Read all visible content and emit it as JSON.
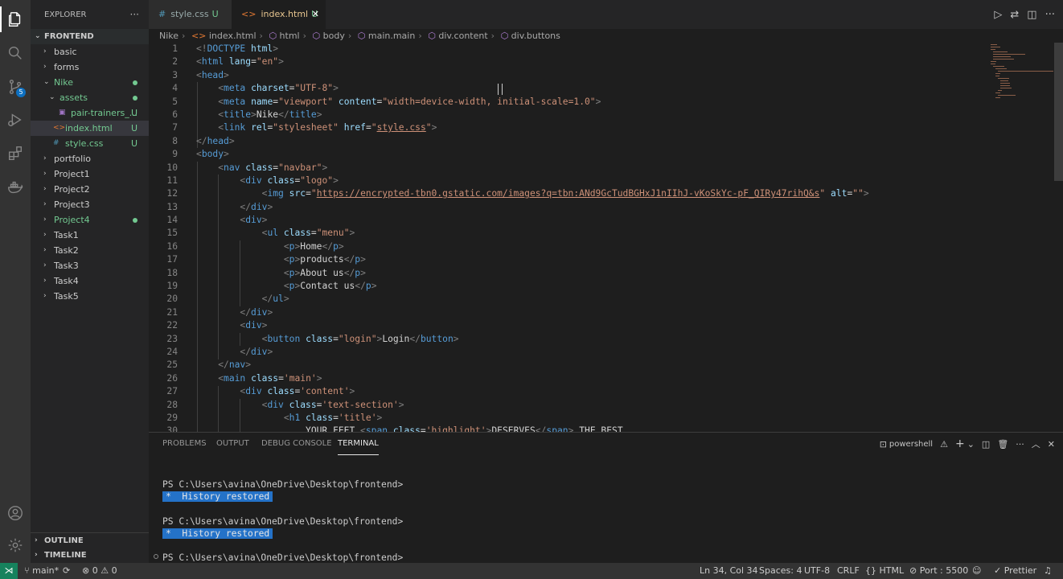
{
  "explorer": {
    "title": "EXPLORER",
    "more": "···",
    "root": "FRONTEND",
    "tree": [
      {
        "label": "basic",
        "chev": "›",
        "indent": 0
      },
      {
        "label": "forms",
        "chev": "›",
        "indent": 0
      },
      {
        "label": "Nike",
        "chev": "⌄",
        "indent": 0,
        "green": true,
        "dot": true
      },
      {
        "label": "assets",
        "chev": "⌄",
        "indent": 1,
        "green": true,
        "dot": true
      },
      {
        "label": "pair-trainers_...",
        "icon": "▣",
        "indent": 2,
        "green": true,
        "badge": "U"
      },
      {
        "label": "index.html",
        "icon": "<>",
        "indent": 1,
        "green": true,
        "badge": "U",
        "selected": true
      },
      {
        "label": "style.css",
        "icon": "#",
        "indent": 1,
        "green": true,
        "badge": "U"
      },
      {
        "label": "portfolio",
        "chev": "›",
        "indent": 0
      },
      {
        "label": "Project1",
        "chev": "›",
        "indent": 0
      },
      {
        "label": "Project2",
        "chev": "›",
        "indent": 0
      },
      {
        "label": "Project3",
        "chev": "›",
        "indent": 0
      },
      {
        "label": "Project4",
        "chev": "›",
        "indent": 0,
        "green": true,
        "dot": true
      },
      {
        "label": "Task1",
        "chev": "›",
        "indent": 0
      },
      {
        "label": "Task2",
        "chev": "›",
        "indent": 0
      },
      {
        "label": "Task3",
        "chev": "›",
        "indent": 0
      },
      {
        "label": "Task4",
        "chev": "›",
        "indent": 0
      },
      {
        "label": "Task5",
        "chev": "›",
        "indent": 0
      }
    ],
    "outline": "OUTLINE",
    "timeline": "TIMELINE"
  },
  "scm_badge": "5",
  "tabs": [
    {
      "icon": "#",
      "label": "style.css",
      "mod": "U"
    },
    {
      "icon": "<>",
      "label": "index.html",
      "mod": "U",
      "close": "✕"
    }
  ],
  "breadcrumbs": [
    "Nike",
    "index.html",
    "html",
    "body",
    "main.main",
    "div.content",
    "div.buttons"
  ],
  "code": [
    {
      "n": "1",
      "src": "<span class=\"b\">&lt;!</span><span class=\"t\">DOCTYPE</span> <span class=\"a\">html</span><span class=\"b\">&gt;</span>"
    },
    {
      "n": "2",
      "src": "<span class=\"b\">&lt;</span><span class=\"t\">html</span> <span class=\"a\">lang</span><span class=\"tx\">=</span><span class=\"s\">\"en\"</span><span class=\"b\">&gt;</span>"
    },
    {
      "n": "3",
      "src": "<span class=\"b\">&lt;</span><span class=\"t\">head</span><span class=\"b\">&gt;</span>"
    },
    {
      "n": "4",
      "src": "    <span class=\"b\">&lt;</span><span class=\"t\">meta</span> <span class=\"a\">charset</span><span class=\"tx\">=</span><span class=\"s\">\"UTF-8\"</span><span class=\"b\">&gt;</span>"
    },
    {
      "n": "5",
      "src": "    <span class=\"b\">&lt;</span><span class=\"t\">meta</span> <span class=\"a\">name</span><span class=\"tx\">=</span><span class=\"s\">\"viewport\"</span> <span class=\"a\">content</span><span class=\"tx\">=</span><span class=\"s\">\"width=device-width, initial-scale=1.0\"</span><span class=\"b\">&gt;</span>"
    },
    {
      "n": "6",
      "src": "    <span class=\"b\">&lt;</span><span class=\"t\">title</span><span class=\"b\">&gt;</span><span class=\"tx\">Nike</span><span class=\"b\">&lt;/</span><span class=\"t\">title</span><span class=\"b\">&gt;</span>"
    },
    {
      "n": "7",
      "src": "    <span class=\"b\">&lt;</span><span class=\"t\">link</span> <span class=\"a\">rel</span><span class=\"tx\">=</span><span class=\"s\">\"stylesheet\"</span> <span class=\"a\">href</span><span class=\"tx\">=</span><span class=\"s\">\"<span class=\"ul\">style.css</span>\"</span><span class=\"b\">&gt;</span>"
    },
    {
      "n": "8",
      "src": "<span class=\"b\">&lt;/</span><span class=\"t\">head</span><span class=\"b\">&gt;</span>"
    },
    {
      "n": "9",
      "src": "<span class=\"b\">&lt;</span><span class=\"t\">body</span><span class=\"b\">&gt;</span>"
    },
    {
      "n": "10",
      "src": "    <span class=\"b\">&lt;</span><span class=\"t\">nav</span> <span class=\"a\">class</span><span class=\"tx\">=</span><span class=\"s\">\"navbar\"</span><span class=\"b\">&gt;</span>"
    },
    {
      "n": "11",
      "src": "        <span class=\"b\">&lt;</span><span class=\"t\">div</span> <span class=\"a\">class</span><span class=\"tx\">=</span><span class=\"s\">\"logo\"</span><span class=\"b\">&gt;</span>"
    },
    {
      "n": "12",
      "src": "            <span class=\"b\">&lt;</span><span class=\"t\">img</span> <span class=\"a\">src</span><span class=\"tx\">=</span><span class=\"s\">\"<span class=\"ul\">https://encrypted-tbn0.gstatic.com/images?q=tbn:ANd9GcTudBGHxJ1nIIhJ-vKoSkYc-pF_QIRy47rihQ&amp;s</span>\"</span> <span class=\"a\">alt</span><span class=\"tx\">=</span><span class=\"s\">\"\"</span><span class=\"b\">&gt;</span>"
    },
    {
      "n": "13",
      "src": "        <span class=\"b\">&lt;/</span><span class=\"t\">div</span><span class=\"b\">&gt;</span>"
    },
    {
      "n": "14",
      "src": "        <span class=\"b\">&lt;</span><span class=\"t\">div</span><span class=\"b\">&gt;</span>"
    },
    {
      "n": "15",
      "src": "            <span class=\"b\">&lt;</span><span class=\"t\">ul</span> <span class=\"a\">class</span><span class=\"tx\">=</span><span class=\"s\">\"menu\"</span><span class=\"b\">&gt;</span>"
    },
    {
      "n": "16",
      "src": "                <span class=\"b\">&lt;</span><span class=\"t\">p</span><span class=\"b\">&gt;</span><span class=\"tx\">Home</span><span class=\"b\">&lt;/</span><span class=\"t\">p</span><span class=\"b\">&gt;</span>"
    },
    {
      "n": "17",
      "src": "                <span class=\"b\">&lt;</span><span class=\"t\">p</span><span class=\"b\">&gt;</span><span class=\"tx\">products</span><span class=\"b\">&lt;/</span><span class=\"t\">p</span><span class=\"b\">&gt;</span>"
    },
    {
      "n": "18",
      "src": "                <span class=\"b\">&lt;</span><span class=\"t\">p</span><span class=\"b\">&gt;</span><span class=\"tx\">About us</span><span class=\"b\">&lt;/</span><span class=\"t\">p</span><span class=\"b\">&gt;</span>"
    },
    {
      "n": "19",
      "src": "                <span class=\"b\">&lt;</span><span class=\"t\">p</span><span class=\"b\">&gt;</span><span class=\"tx\">Contact us</span><span class=\"b\">&lt;/</span><span class=\"t\">p</span><span class=\"b\">&gt;</span>"
    },
    {
      "n": "20",
      "src": "            <span class=\"b\">&lt;/</span><span class=\"t\">ul</span><span class=\"b\">&gt;</span>"
    },
    {
      "n": "21",
      "src": "        <span class=\"b\">&lt;/</span><span class=\"t\">div</span><span class=\"b\">&gt;</span>"
    },
    {
      "n": "22",
      "src": "        <span class=\"b\">&lt;</span><span class=\"t\">div</span><span class=\"b\">&gt;</span>"
    },
    {
      "n": "23",
      "src": "            <span class=\"b\">&lt;</span><span class=\"t\">button</span> <span class=\"a\">class</span><span class=\"tx\">=</span><span class=\"s\">\"login\"</span><span class=\"b\">&gt;</span><span class=\"tx\">Login</span><span class=\"b\">&lt;/</span><span class=\"t\">button</span><span class=\"b\">&gt;</span>"
    },
    {
      "n": "24",
      "src": "        <span class=\"b\">&lt;/</span><span class=\"t\">div</span><span class=\"b\">&gt;</span>"
    },
    {
      "n": "25",
      "src": "    <span class=\"b\">&lt;/</span><span class=\"t\">nav</span><span class=\"b\">&gt;</span>"
    },
    {
      "n": "26",
      "src": "    <span class=\"b\">&lt;</span><span class=\"t\">main</span> <span class=\"a\">class</span><span class=\"tx\">=</span><span class=\"s\">'main'</span><span class=\"b\">&gt;</span>"
    },
    {
      "n": "27",
      "src": "        <span class=\"b\">&lt;</span><span class=\"t\">div</span> <span class=\"a\">class</span><span class=\"tx\">=</span><span class=\"s\">'content'</span><span class=\"b\">&gt;</span>"
    },
    {
      "n": "28",
      "src": "            <span class=\"b\">&lt;</span><span class=\"t\">div</span> <span class=\"a\">class</span><span class=\"tx\">=</span><span class=\"s\">'text-section'</span><span class=\"b\">&gt;</span>"
    },
    {
      "n": "29",
      "src": "                <span class=\"b\">&lt;</span><span class=\"t\">h1</span> <span class=\"a\">class</span><span class=\"tx\">=</span><span class=\"s\">'title'</span><span class=\"b\">&gt;</span>"
    },
    {
      "n": "30",
      "src": "                    <span class=\"tx\">YOUR FEET </span><span class=\"b\">&lt;</span><span class=\"t\">span</span> <span class=\"a\">class</span><span class=\"tx\">=</span><span class=\"s\">'highlight'</span><span class=\"b\">&gt;</span><span class=\"tx\">DESERVES</span><span class=\"b\">&lt;/</span><span class=\"t\">span</span><span class=\"b\">&gt;</span><span class=\"tx\"> THE BEST</span>"
    }
  ],
  "panel": {
    "tabs": [
      "PROBLEMS",
      "OUTPUT",
      "DEBUG CONSOLE",
      "TERMINAL"
    ],
    "shell": "powershell",
    "terminal": [
      {
        "type": "prompt",
        "text": "PS C:\\Users\\avina\\OneDrive\\Desktop\\frontend>"
      },
      {
        "type": "hist",
        "star": "*",
        "text": "History restored"
      },
      {
        "type": "prompt",
        "text": "PS C:\\Users\\avina\\OneDrive\\Desktop\\frontend>"
      },
      {
        "type": "hist",
        "star": "*",
        "text": "History restored"
      },
      {
        "type": "prompt",
        "text": "PS C:\\Users\\avina\\OneDrive\\Desktop\\frontend>"
      }
    ]
  },
  "status": {
    "branch": "main*",
    "errors": "0",
    "warnings": "0",
    "position": "Ln 34, Col 34",
    "spaces": "Spaces: 4",
    "encoding": "UTF-8",
    "eol": "CRLF",
    "language": "HTML",
    "port": "Port : 5500",
    "prettier": "Prettier"
  }
}
